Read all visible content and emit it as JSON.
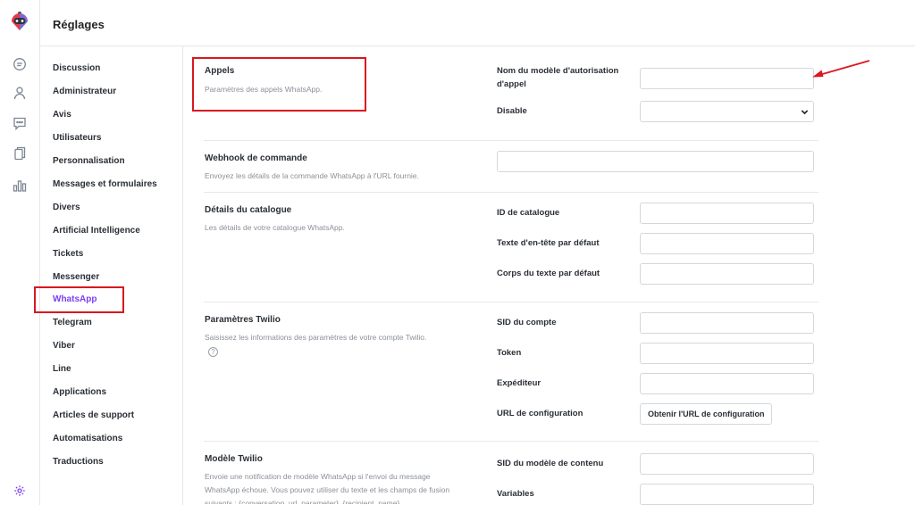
{
  "header": {
    "title": "Réglages"
  },
  "rail": {
    "icons": [
      "logo-icon",
      "chat-icon",
      "user-icon",
      "message-square-icon",
      "documents-icon",
      "bar-chart-icon",
      "settings-gear-icon"
    ]
  },
  "sidebar": {
    "items": [
      {
        "label": "Discussion"
      },
      {
        "label": "Administrateur"
      },
      {
        "label": "Avis"
      },
      {
        "label": "Utilisateurs"
      },
      {
        "label": "Personnalisation"
      },
      {
        "label": "Messages et formulaires"
      },
      {
        "label": "Divers"
      },
      {
        "label": "Artificial Intelligence"
      },
      {
        "label": "Tickets"
      },
      {
        "label": "Messenger"
      },
      {
        "label": "WhatsApp"
      },
      {
        "label": "Telegram"
      },
      {
        "label": "Viber"
      },
      {
        "label": "Line"
      },
      {
        "label": "Applications"
      },
      {
        "label": "Articles de support"
      },
      {
        "label": "Automatisations"
      },
      {
        "label": "Traductions"
      }
    ],
    "active": "WhatsApp"
  },
  "sections": {
    "appels": {
      "title": "Appels",
      "desc": "Paramètres des appels WhatsApp.",
      "field1_label": "Nom du modèle d'autorisation d'appel",
      "field1_value": "",
      "field2_label": "Disable",
      "field2_value": ""
    },
    "webhook": {
      "title": "Webhook de commande",
      "desc": "Envoyez les détails de la commande WhatsApp à l'URL fournie.",
      "value": ""
    },
    "catalogue": {
      "title": "Détails du catalogue",
      "desc": "Les détails de votre catalogue WhatsApp.",
      "f1_label": "ID de catalogue",
      "f1_value": "",
      "f2_label": "Texte d'en-tête par défaut",
      "f2_value": "",
      "f3_label": "Corps du texte par défaut",
      "f3_value": ""
    },
    "twilio": {
      "title": "Paramètres Twilio",
      "desc": "Saisissez les informations des paramètres de votre compte Twilio.",
      "help": "?",
      "f1_label": "SID du compte",
      "f1_value": "",
      "f2_label": "Token",
      "f2_value": "",
      "f3_label": "Expéditeur",
      "f3_value": "",
      "f4_label": "URL de configuration",
      "button": "Obtenir l'URL de configuration"
    },
    "modele": {
      "title": "Modèle Twilio",
      "desc": "Envoie une notification de modèle WhatsApp si l'envoi du message WhatsApp échoue. Vous pouvez utiliser du texte et les champs de fusion suivants : {conversation_url_parameter}, {recipient_name},",
      "f1_label": "SID du modèle de contenu",
      "f1_value": "",
      "f2_label": "Variables",
      "f2_value": ""
    }
  },
  "annotations": {
    "color": "#d9181f"
  },
  "colors": {
    "accent": "#7b3ff2"
  }
}
